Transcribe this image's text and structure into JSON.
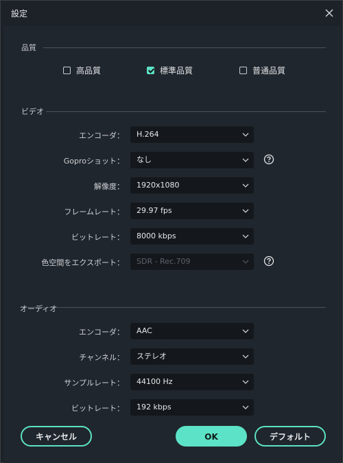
{
  "window": {
    "title": "設定"
  },
  "quality": {
    "section_title": "品質",
    "options": [
      {
        "label": "高品質",
        "checked": false
      },
      {
        "label": "標準品質",
        "checked": true
      },
      {
        "label": "普通品質",
        "checked": false
      }
    ]
  },
  "video": {
    "section_title": "ビデオ",
    "rows": [
      {
        "label": "エンコーダ：",
        "value": "H.264",
        "disabled": false
      },
      {
        "label": "Goproショット：",
        "value": "なし",
        "disabled": false,
        "help": true
      },
      {
        "label": "解像度：",
        "value": "1920x1080",
        "disabled": false
      },
      {
        "label": "フレームレート：",
        "value": "29.97 fps",
        "disabled": false
      },
      {
        "label": "ビットレート：",
        "value": "8000 kbps",
        "disabled": false
      },
      {
        "label": "色空間をエクスポート：",
        "value": "SDR - Rec.709",
        "disabled": true,
        "help": true
      }
    ]
  },
  "audio": {
    "section_title": "オーディオ",
    "rows": [
      {
        "label": "エンコーダ：",
        "value": "AAC"
      },
      {
        "label": "チャンネル：",
        "value": "ステレオ"
      },
      {
        "label": "サンプルレート：",
        "value": "44100 Hz"
      },
      {
        "label": "ビットレート：",
        "value": "192 kbps"
      }
    ]
  },
  "buttons": {
    "cancel": "キャンセル",
    "ok": "OK",
    "default": "デフォルト"
  },
  "colors": {
    "accent": "#5ce2c6",
    "background": "#20262d",
    "field": "#14181c"
  }
}
